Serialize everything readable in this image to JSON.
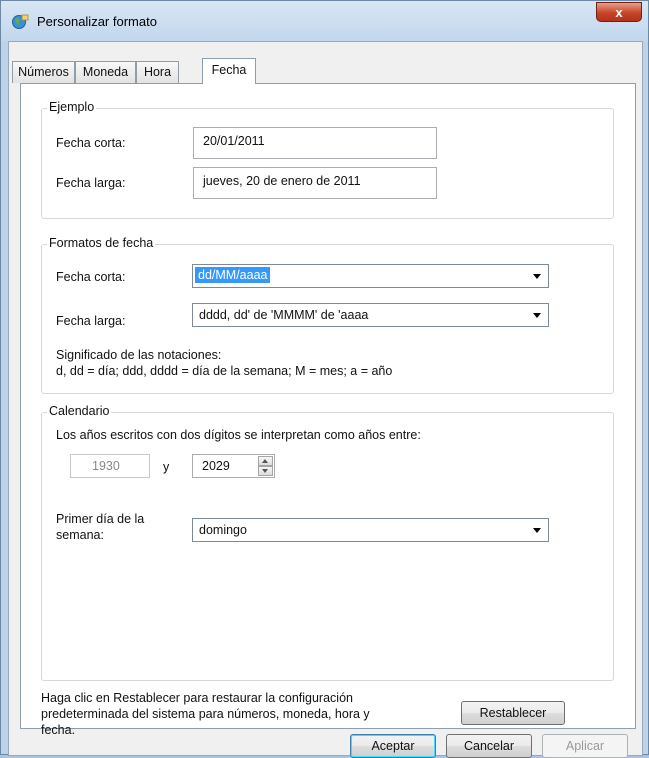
{
  "window": {
    "title": "Personalizar formato",
    "close_label": "x"
  },
  "tabs": [
    {
      "label": "Números",
      "active": false
    },
    {
      "label": "Moneda",
      "active": false
    },
    {
      "label": "Hora",
      "active": false
    },
    {
      "label": "Fecha",
      "active": true
    }
  ],
  "ejemplo": {
    "legend": "Ejemplo",
    "fecha_corta_label": "Fecha corta:",
    "fecha_corta_value": "20/01/2011",
    "fecha_larga_label": "Fecha larga:",
    "fecha_larga_value": "jueves, 20 de enero de 2011"
  },
  "formatos": {
    "legend": "Formatos de fecha",
    "fecha_corta_label": "Fecha corta:",
    "fecha_corta_value": "dd/MM/aaaa",
    "fecha_larga_label": "Fecha larga:",
    "fecha_larga_value": "dddd, dd' de 'MMMM' de 'aaaa",
    "notaciones_title": "Significado de las notaciones:",
    "notaciones_text": "d, dd = día;  ddd, dddd = día de la semana; M = mes; a = año"
  },
  "calendario": {
    "legend": "Calendario",
    "description": "Los años escritos con dos dígitos se interpretan como años entre:",
    "year_from": "1930",
    "y_label": "y",
    "year_to": "2029",
    "primer_dia_label_1": "Primer día de la",
    "primer_dia_label_2": "semana:",
    "primer_dia_value": "domingo"
  },
  "reset": {
    "text_1": "Haga clic en Restablecer para restaurar la configuración",
    "text_2": "predeterminada del sistema para números, moneda, hora y",
    "text_3": "fecha.",
    "button_label": "Restablecer"
  },
  "buttons": {
    "ok": "Aceptar",
    "cancel": "Cancelar",
    "apply": "Aplicar"
  },
  "colors": {
    "selection": "#3399ff",
    "close_button": "#c7442a"
  }
}
